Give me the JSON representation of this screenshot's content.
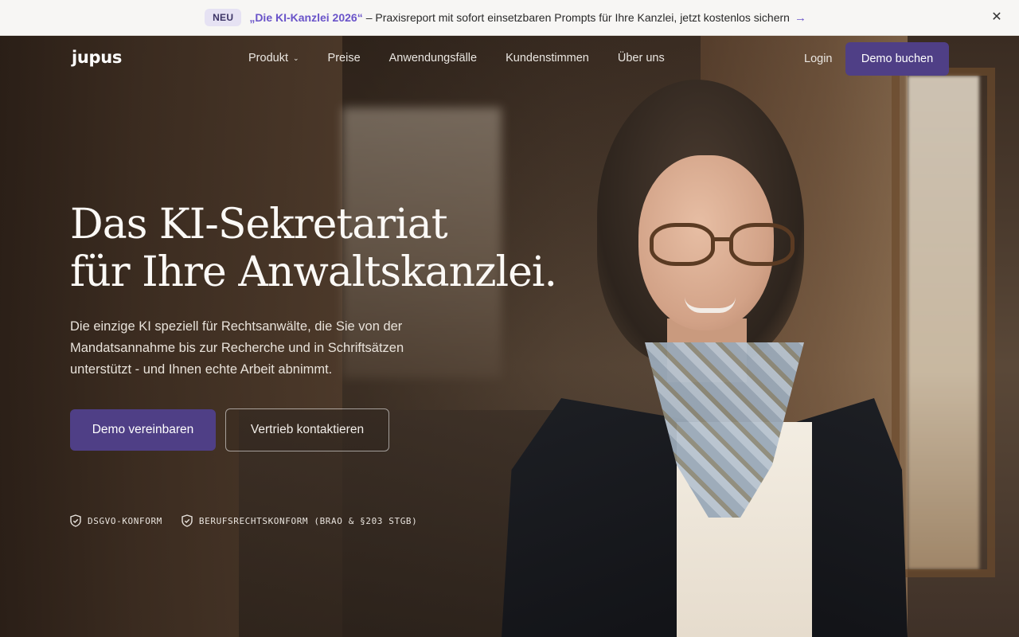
{
  "banner": {
    "badge": "NEU",
    "highlight": "„Die KI-Kanzlei 2026“",
    "text": "– Praxisreport mit sofort einsetzbaren Prompts für Ihre Kanzlei, jetzt kostenlos sichern",
    "arrow_icon": "arrow-right-icon",
    "close_icon": "close-icon"
  },
  "nav": {
    "logo": "jupus",
    "links": [
      {
        "label": "Produkt",
        "has_dropdown": true
      },
      {
        "label": "Preise"
      },
      {
        "label": "Anwendungsfälle"
      },
      {
        "label": "Kundenstimmen"
      },
      {
        "label": "Über uns"
      }
    ],
    "login": "Login",
    "demo": "Demo buchen"
  },
  "hero": {
    "headline_line1": "Das KI-Sekretariat",
    "headline_line2": "für Ihre Anwaltskanzlei.",
    "subtext": "Die einzige KI speziell für Rechtsanwälte, die Sie von der Mandatsannahme bis zur Recherche und in Schriftsätzen unterstützt - und Ihnen echte Arbeit abnimmt.",
    "cta_primary": "Demo vereinbaren",
    "cta_secondary": "Vertrieb kontaktieren",
    "trust": [
      {
        "icon": "shield-check-icon",
        "label": "DSGVO-KONFORM"
      },
      {
        "icon": "shield-check-icon",
        "label": "BERUFSRECHTSKONFORM (BRAO & §203 STGB)"
      }
    ]
  },
  "colors": {
    "accent": "#4f3f86",
    "banner_highlight": "#6a54c9",
    "banner_bg": "#f7f6f4"
  }
}
